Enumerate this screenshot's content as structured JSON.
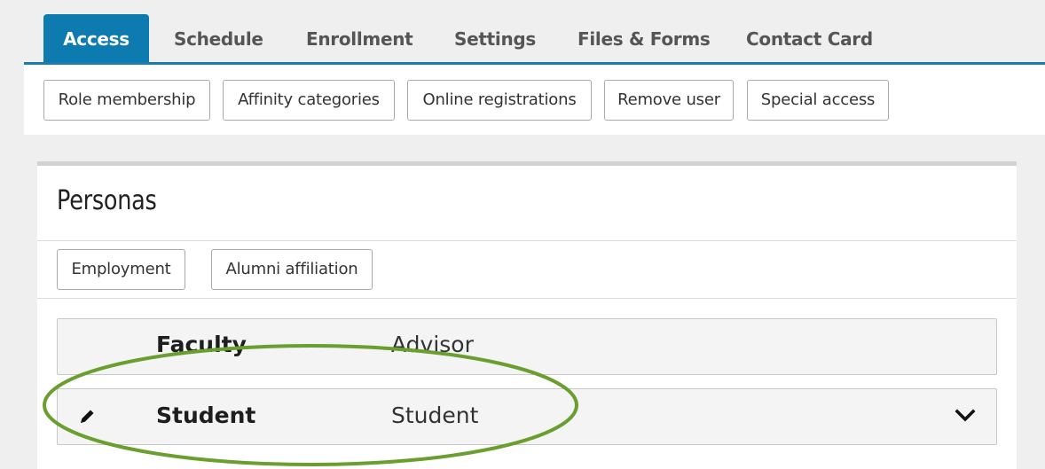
{
  "tabs": [
    {
      "label": "Access",
      "active": true
    },
    {
      "label": "Schedule",
      "active": false
    },
    {
      "label": "Enrollment",
      "active": false
    },
    {
      "label": "Settings",
      "active": false
    },
    {
      "label": "Files & Forms",
      "active": false
    },
    {
      "label": "Contact Card",
      "active": false
    }
  ],
  "access_buttons": [
    "Role membership",
    "Affinity categories",
    "Online registrations",
    "Remove user",
    "Special access"
  ],
  "personas": {
    "title": "Personas",
    "buttons": [
      "Employment",
      "Alumni affiliation"
    ],
    "rows": [
      {
        "name": "Faculty",
        "role": "Advisor",
        "edit_icon": "",
        "expand_icon": ""
      },
      {
        "name": "Student",
        "role": "Student",
        "edit_icon": "pencil-icon",
        "expand_icon": "chevron-down-icon"
      }
    ]
  },
  "colors": {
    "accent": "#0e7bb0",
    "highlight_ellipse": "#6a9e2e"
  }
}
